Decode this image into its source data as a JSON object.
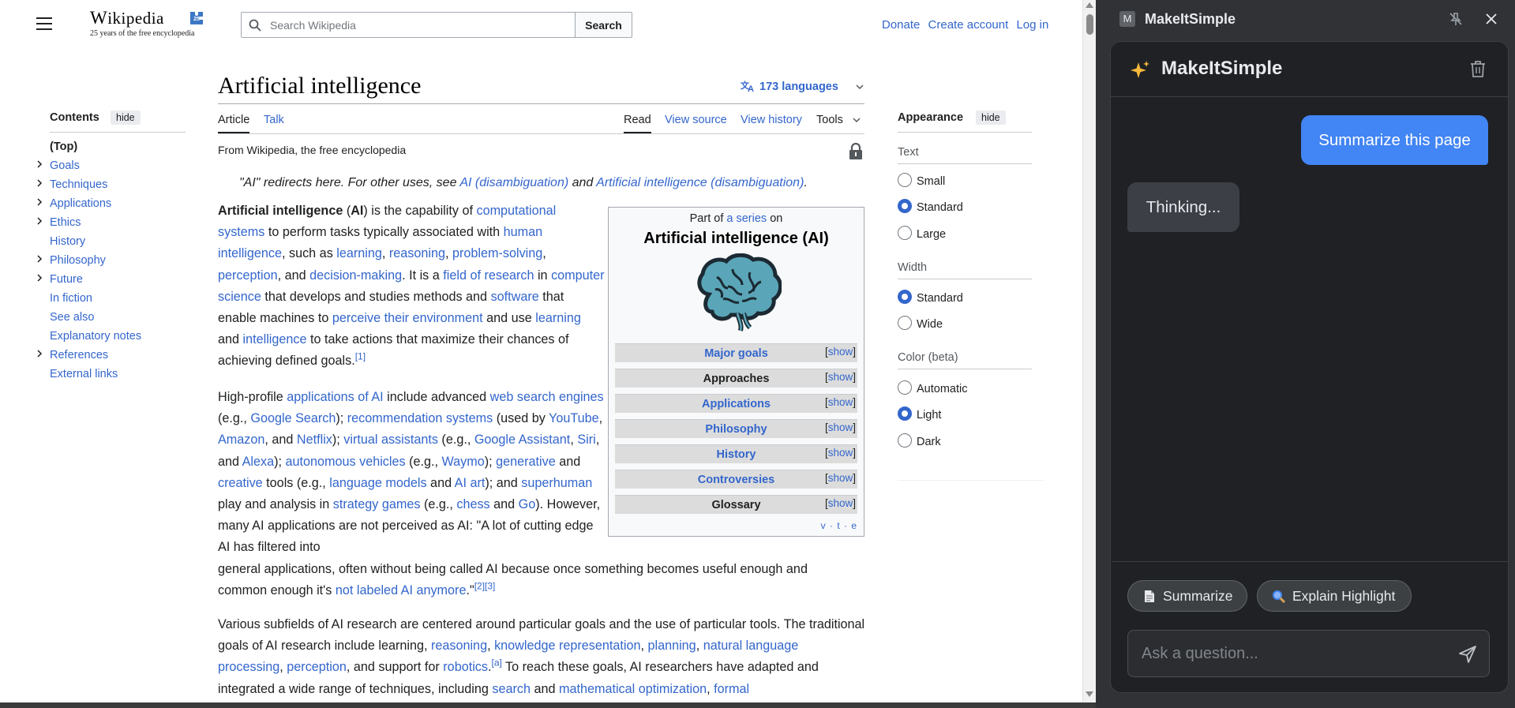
{
  "wiki": {
    "logo_word": "Wikipedia",
    "logo_tagline": "25 years of the free encyclopedia",
    "search_placeholder": "Search Wikipedia",
    "search_button": "Search",
    "user_links": [
      "Donate",
      "Create account",
      "Log in"
    ]
  },
  "toc": {
    "title": "Contents",
    "hide": "hide",
    "items": [
      {
        "label": "(Top)",
        "expandable": false
      },
      {
        "label": "Goals",
        "expandable": true
      },
      {
        "label": "Techniques",
        "expandable": true
      },
      {
        "label": "Applications",
        "expandable": true
      },
      {
        "label": "Ethics",
        "expandable": true
      },
      {
        "label": "History",
        "expandable": false
      },
      {
        "label": "Philosophy",
        "expandable": true
      },
      {
        "label": "Future",
        "expandable": true
      },
      {
        "label": "In fiction",
        "expandable": false
      },
      {
        "label": "See also",
        "expandable": false
      },
      {
        "label": "Explanatory notes",
        "expandable": false
      },
      {
        "label": "References",
        "expandable": true
      },
      {
        "label": "External links",
        "expandable": false
      }
    ]
  },
  "article": {
    "title": "Artificial intelligence",
    "languages": "173 languages",
    "tabs_left": [
      "Article",
      "Talk"
    ],
    "tabs_right": [
      "Read",
      "View source",
      "View history",
      "Tools"
    ],
    "from": "From Wikipedia, the free encyclopedia",
    "hatnote": {
      "prefix": "\"AI\" redirects here. For other uses, see ",
      "link1": "AI (disambiguation)",
      "mid": " and ",
      "link2": "Artificial intelligence (disambiguation)",
      "suffix": "."
    }
  },
  "infobox": {
    "part_prefix": "Part of ",
    "part_link": "a series",
    "part_suffix": " on",
    "title": "Artificial intelligence (AI)",
    "rows": [
      {
        "label": "Major goals",
        "link": true
      },
      {
        "label": "Approaches",
        "link": false
      },
      {
        "label": "Applications",
        "link": true
      },
      {
        "label": "Philosophy",
        "link": true
      },
      {
        "label": "History",
        "link": true
      },
      {
        "label": "Controversies",
        "link": true
      },
      {
        "label": "Glossary",
        "link": false
      }
    ],
    "show": "show",
    "vte": "v · t · e"
  },
  "appearance": {
    "title": "Appearance",
    "hide": "hide",
    "text_label": "Text",
    "text_options": [
      "Small",
      "Standard",
      "Large"
    ],
    "text_selected": "Standard",
    "width_label": "Width",
    "width_options": [
      "Standard",
      "Wide"
    ],
    "width_selected": "Standard",
    "color_label": "Color (beta)",
    "color_options": [
      "Automatic",
      "Light",
      "Dark"
    ],
    "color_selected": "Light"
  },
  "panel": {
    "favicon_letter": "M",
    "name": "MakeItSimple",
    "app_title": "MakeItSimple",
    "user_message": "Summarize this page",
    "bot_message": "Thinking...",
    "chip_summarize": "Summarize",
    "chip_explain": "Explain Highlight",
    "ask_placeholder": "Ask a question...",
    "accent": "#4285f4"
  }
}
